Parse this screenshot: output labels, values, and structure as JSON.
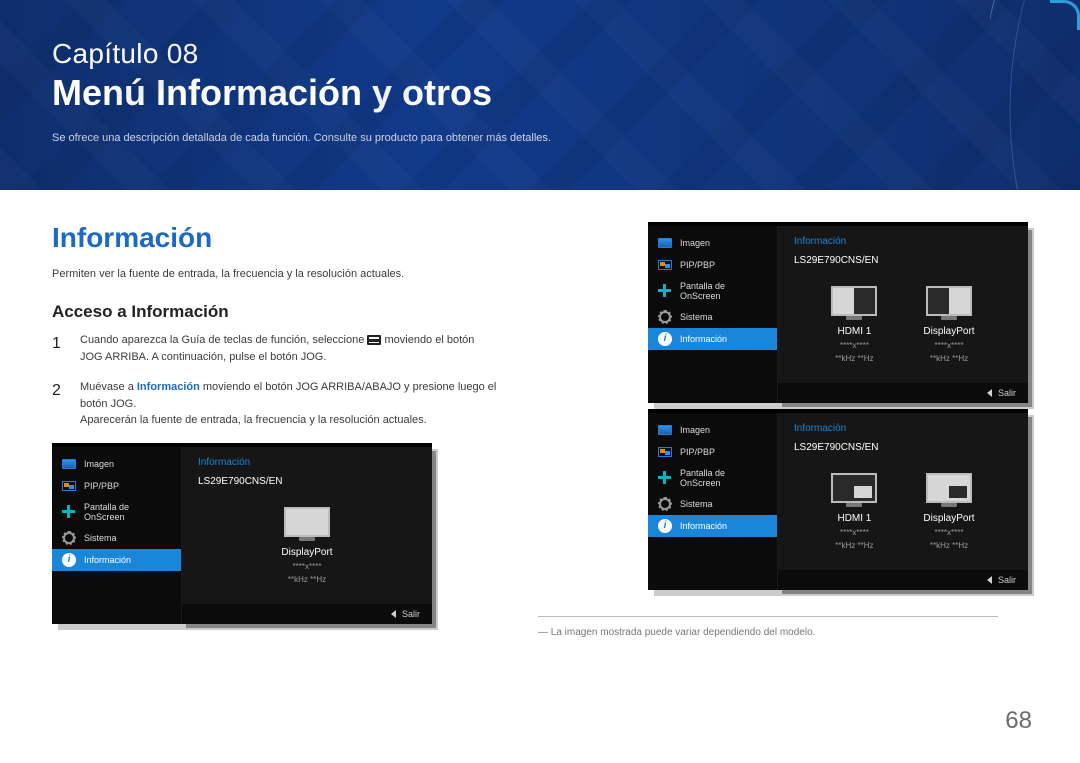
{
  "chapter_label": "Capítulo 08",
  "chapter_title": "Menú Información y otros",
  "chapter_subtitle": "Se ofrece una descripción detallada de cada función. Consulte su producto para obtener más detalles.",
  "section_heading": "Información",
  "lead_text": "Permiten ver la fuente de entrada, la frecuencia y la resolución actuales.",
  "subheading": "Acceso a Información",
  "steps": {
    "s1": {
      "num": "1",
      "pre": "Cuando aparezca la Guía de teclas de función, seleccione ",
      "post": " moviendo el botón JOG ARRIBA. A continuación, pulse el botón JOG."
    },
    "s2": {
      "num": "2",
      "pre": "Muévase a ",
      "emph": "Información",
      "post": " moviendo el botón JOG ARRIBA/ABAJO y presione luego el botón JOG.",
      "line2": "Aparecerán la fuente de entrada, la frecuencia y la resolución actuales."
    }
  },
  "osd_menu": {
    "items": [
      "Imagen",
      "PIP/PBP",
      "Pantalla de OnScreen",
      "Sistema",
      "Información"
    ],
    "panel_title": "Información",
    "model": "LS29E790CNS/EN",
    "exit": "Salir"
  },
  "sources": {
    "dp": {
      "label": "DisplayPort",
      "res": "****x****",
      "hz": "**kHz **Hz"
    },
    "hdmi1": {
      "label": "HDMI 1",
      "res": "****x****",
      "hz": "**kHz **Hz"
    }
  },
  "footnote": "― La imagen mostrada puede variar dependiendo del modelo.",
  "page_number": "68"
}
